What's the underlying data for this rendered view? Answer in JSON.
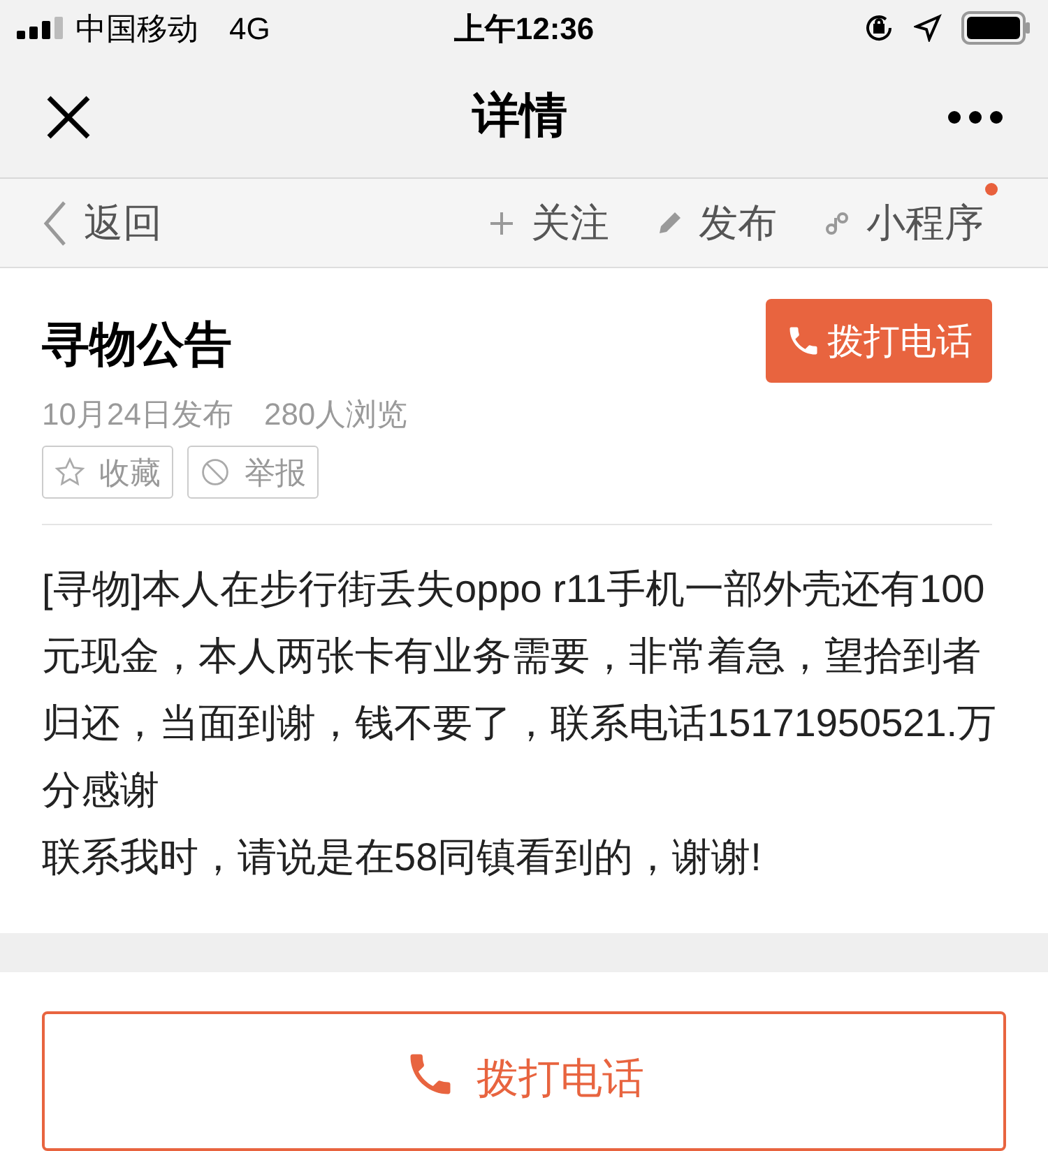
{
  "status_bar": {
    "carrier": "中国移动",
    "network": "4G",
    "time": "上午12:36"
  },
  "nav_bar": {
    "title": "详情"
  },
  "toolbar": {
    "back": "返回",
    "actions": [
      {
        "kind": "plus",
        "label": "关注",
        "dot": false
      },
      {
        "kind": "pen",
        "label": "发布",
        "dot": false
      },
      {
        "kind": "link",
        "label": "小程序",
        "dot": true
      }
    ]
  },
  "post": {
    "title": "寻物公告",
    "call_button": "拨打电话",
    "date": "10月24日发布",
    "views": "280人浏览",
    "actions": [
      {
        "kind": "star",
        "label": "收藏"
      },
      {
        "kind": "block",
        "label": "举报"
      }
    ],
    "paragraphs": [
      "[寻物]本人在步行街丢失oppo r11手机一部外壳还有100元现金，本人两张卡有业务需要，非常着急，望拾到者归还，当面到谢，钱不要了，联系电话15171950521.万分感谢",
      "联系我时，请说是在58同镇看到的，谢谢!"
    ]
  },
  "bottom_button": "拨打电话"
}
